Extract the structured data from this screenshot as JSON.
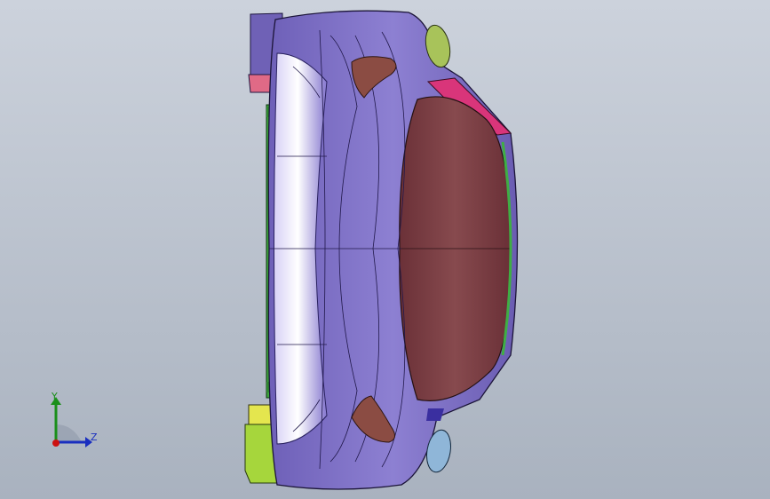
{
  "viewport": {
    "background_top": "#ccd2dc",
    "background_bottom": "#a9b2bf"
  },
  "model": {
    "body_color": "#7a6cc4",
    "hood_color": "#7a3f45",
    "accent_pink": "#d9357a",
    "accent_green": "#9acd32",
    "accent_yellow": "#e6e84a",
    "accent_light_blue": "#8fb6d8",
    "bump_color": "#8a4a40"
  },
  "triad": {
    "y_label": "Y",
    "z_label": "Z",
    "y_color": "#1a8f1a",
    "z_color": "#1a2fbf",
    "x_color": "#cc1111"
  }
}
